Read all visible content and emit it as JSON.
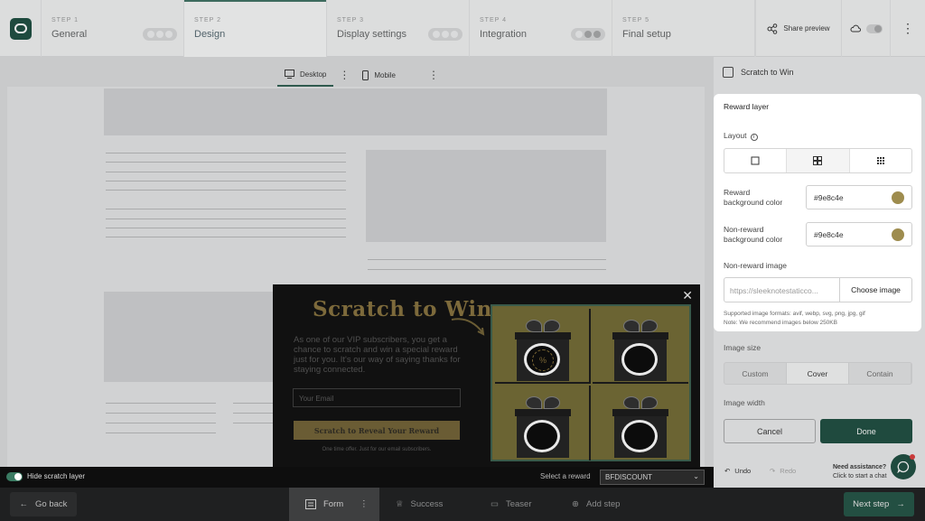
{
  "steps": [
    {
      "num": "STEP 1",
      "label": "General"
    },
    {
      "num": "STEP 2",
      "label": "Design"
    },
    {
      "num": "STEP 3",
      "label": "Display settings"
    },
    {
      "num": "STEP 4",
      "label": "Integration"
    },
    {
      "num": "STEP 5",
      "label": "Final setup"
    }
  ],
  "header": {
    "share_label": "Share preview"
  },
  "device_tabs": {
    "desktop": "Desktop",
    "mobile": "Mobile"
  },
  "popup": {
    "title": "Scratch to Win",
    "body": "As one of our VIP subscribers, you get a chance to scratch and win a special reward just for you. It's our way of saying thanks for staying connected.",
    "email_placeholder": "Your Email",
    "cta": "Scratch to Reveal Your Reward",
    "note": "One time offer. Just for our email subscribers.",
    "reward_badge": "%"
  },
  "canvas_footer": {
    "hide_label": "Hide scratch layer",
    "select_reward_label": "Select a reward",
    "selected_reward": "BFDISCOUNT"
  },
  "panel": {
    "title": "Scratch to Win",
    "section_title": "Reward layer",
    "layout_label": "Layout",
    "reward_bg_label_1": "Reward",
    "reward_bg_label_2": "background color",
    "reward_bg_value": "#9e8c4e",
    "nonreward_bg_label_1": "Non-reward",
    "nonreward_bg_label_2": "background color",
    "nonreward_bg_value": "#9e8c4e",
    "nonreward_image_label": "Non-reward image",
    "nonreward_image_url": "https://sleeknotestaticco...",
    "choose_image": "Choose image",
    "help_1": "Supported image formats: avif, webp, svg, png, jpg, gif",
    "help_2": "Note: We recommend images below 250KB",
    "image_size_label": "Image size",
    "image_size_options": [
      "Custom",
      "Cover",
      "Contain"
    ],
    "image_width_label": "Image width",
    "cancel": "Cancel",
    "done": "Done",
    "undo": "Undo",
    "redo": "Redo",
    "assist_title": "Need assistance?",
    "assist_sub": "Click to start a chat"
  },
  "bottom": {
    "go_back": "Go back",
    "tabs": [
      "Form",
      "Success",
      "Teaser",
      "Add step"
    ],
    "next": "Next step"
  },
  "colors": {
    "accent": "#1f4a3e",
    "gold": "#9e8c4e"
  }
}
